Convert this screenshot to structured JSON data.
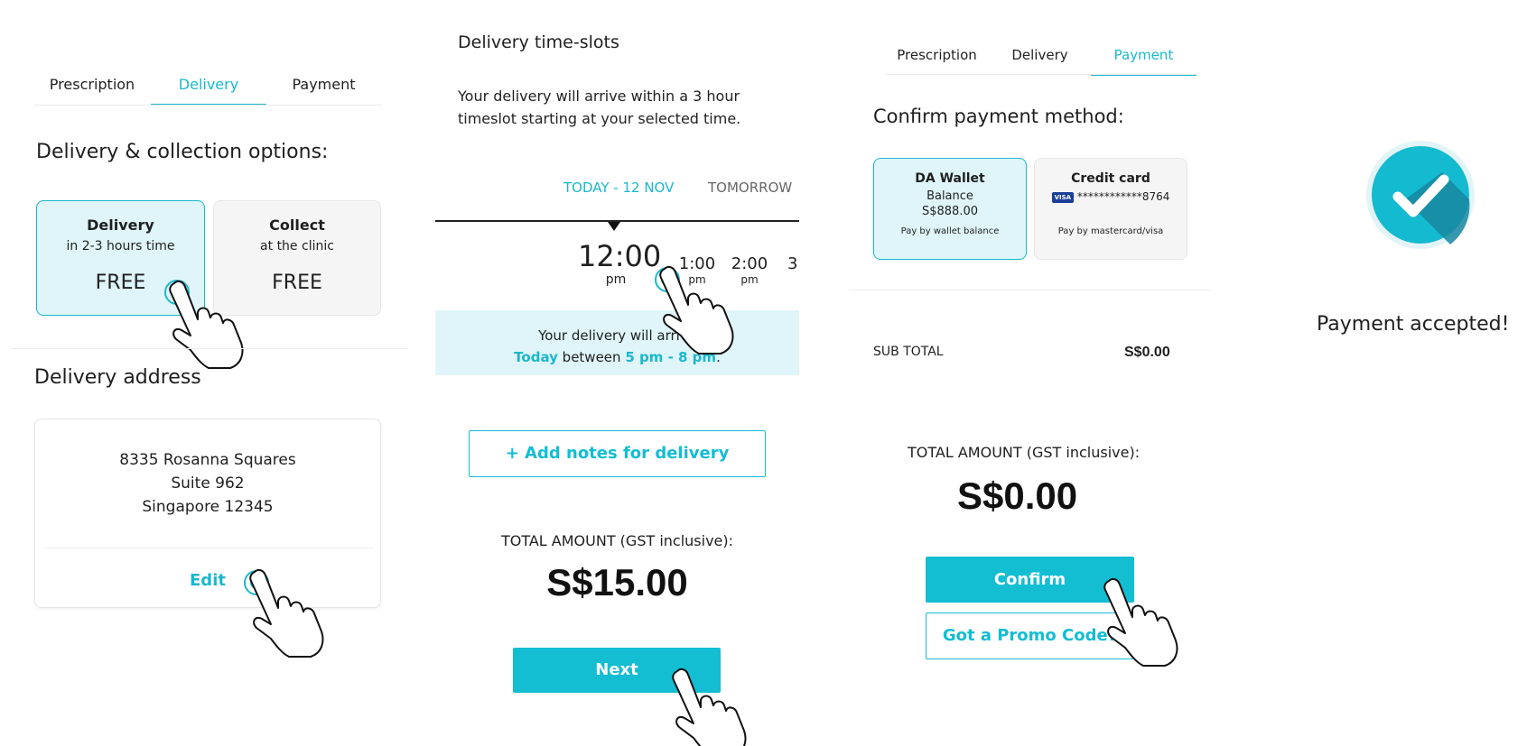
{
  "screen1": {
    "tabs": [
      "Prescription",
      "Delivery",
      "Payment"
    ],
    "active_tab": "Delivery",
    "options_title": "Delivery & collection options:",
    "option_delivery": {
      "title": "Delivery",
      "subtitle": "in 2-3 hours time",
      "price": "FREE"
    },
    "option_collect": {
      "title": "Collect",
      "subtitle": "at the clinic",
      "price": "FREE"
    },
    "address_title": "Delivery address",
    "address_lines": [
      "8335 Rosanna Squares",
      "Suite 962",
      "Singapore 12345"
    ],
    "edit_label": "Edit"
  },
  "screen2": {
    "title": "Delivery time-slots",
    "description_line1": "Your delivery will arrive within a 3 hour",
    "description_line2": "timeslot starting at your selected time.",
    "day_tabs": [
      "TODAY - 12 NOV",
      "TOMORROW"
    ],
    "selected_time": "12:00",
    "selected_period": "pm",
    "slots": [
      {
        "time": "1:00",
        "period": "pm"
      },
      {
        "time": "2:00",
        "period": "pm"
      },
      {
        "time": "3",
        "period": ""
      }
    ],
    "arrival_line1": "Your delivery will arrive",
    "arrival_day": "Today",
    "arrival_between": "between",
    "arrival_range": "5 pm - 8 pm",
    "arrival_end": ".",
    "add_notes_label": "+ Add notes for delivery",
    "total_label": "TOTAL AMOUNT (GST inclusive):",
    "total_amount": "S$15.00",
    "next_label": "Next"
  },
  "screen3": {
    "tabs": [
      "Prescription",
      "Delivery",
      "Payment"
    ],
    "active_tab": "Payment",
    "confirm_title": "Confirm payment method:",
    "wallet": {
      "title": "DA Wallet",
      "line1": "Balance",
      "line2": "S$888.00",
      "footer": "Pay by wallet balance"
    },
    "credit": {
      "title": "Credit card",
      "card_brand": "VISA",
      "card_number": "************8764",
      "footer": "Pay by mastercard/visa"
    },
    "subtotal_label": "SUB TOTAL",
    "subtotal_value": "S$0.00",
    "total_label": "TOTAL AMOUNT (GST inclusive):",
    "total_amount": "S$0.00",
    "confirm_label": "Confirm",
    "promo_label": "Got a Promo Code?"
  },
  "screen4": {
    "message": "Payment accepted!"
  },
  "colors": {
    "accent": "#1ab8cc",
    "accent_fill": "#13bdd2",
    "selected_bg": "#dff5f9",
    "check_shadow": "#1687a0"
  }
}
